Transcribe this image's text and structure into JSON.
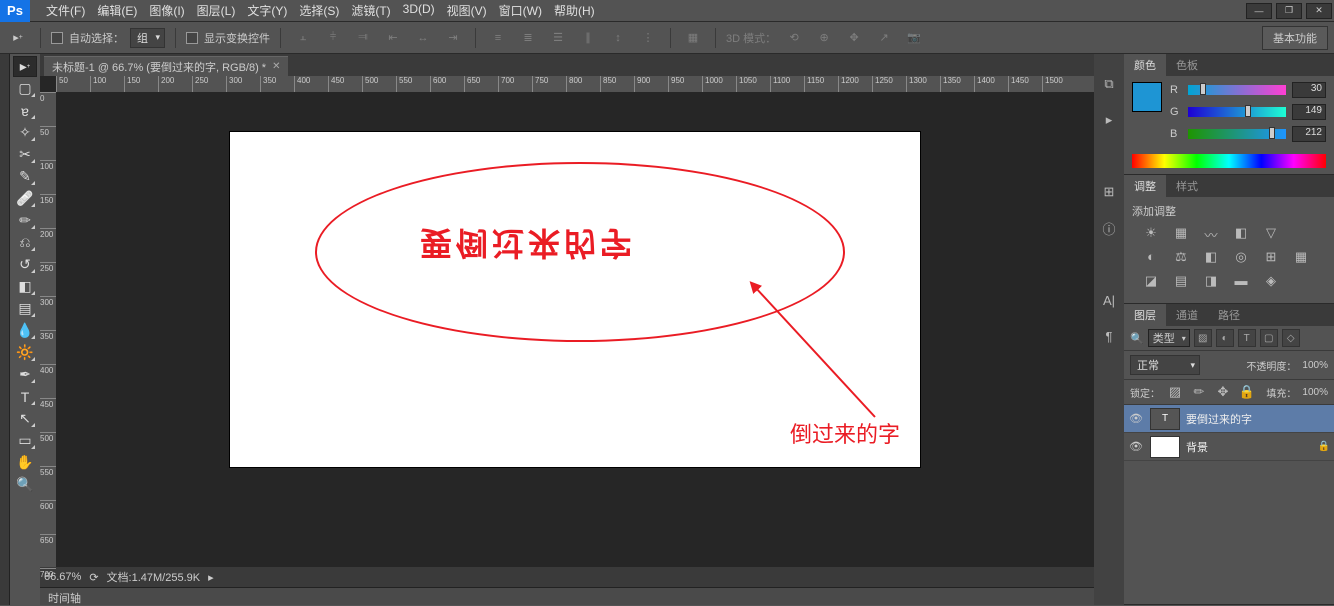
{
  "menu": {
    "items": [
      "文件(F)",
      "编辑(E)",
      "图像(I)",
      "图层(L)",
      "文字(Y)",
      "选择(S)",
      "滤镜(T)",
      "3D(D)",
      "视图(V)",
      "窗口(W)",
      "帮助(H)"
    ]
  },
  "options": {
    "auto_select_label": "自动选择：",
    "auto_select_value": "组",
    "show_transform_label": "显示变换控件",
    "mode3d_label": "3D 模式：",
    "workspace_btn": "基本功能"
  },
  "doc": {
    "tab_title": "未标题-1 @ 66.7% (要倒过来的字, RGB/8) *",
    "zoom": "66.67%",
    "doc_info": "文档:1.47M/255.9K",
    "timeline_tab": "时间轴",
    "canvas_text": "要倒过来的字",
    "annotation": "倒过来的字"
  },
  "ruler_h": [
    "50",
    "100",
    "150",
    "200",
    "250",
    "300",
    "350",
    "400",
    "450",
    "500",
    "550",
    "600",
    "650",
    "700",
    "750",
    "800",
    "850",
    "900",
    "950",
    "1000",
    "1050",
    "1100",
    "1150",
    "1200",
    "1250",
    "1300",
    "1350",
    "1400",
    "1450",
    "1500"
  ],
  "ruler_v": [
    "0",
    "50",
    "100",
    "150",
    "200",
    "250",
    "300",
    "350",
    "400",
    "450",
    "500",
    "550",
    "600",
    "650",
    "700"
  ],
  "color_panel": {
    "tab1": "颜色",
    "tab2": "色板",
    "r": {
      "label": "R",
      "val": "30"
    },
    "g": {
      "label": "G",
      "val": "149"
    },
    "b": {
      "label": "B",
      "val": "212"
    }
  },
  "adjust_panel": {
    "tab1": "调整",
    "tab2": "样式",
    "title": "添加调整"
  },
  "layers_panel": {
    "tab1": "图层",
    "tab2": "通道",
    "tab3": "路径",
    "search_label": "类型",
    "blend": "正常",
    "opacity_label": "不透明度：",
    "opacity_val": "100%",
    "lock_label": "锁定：",
    "fill_label": "填充：",
    "fill_val": "100%",
    "layers": [
      {
        "name": "要倒过来的字",
        "type": "T",
        "selected": true,
        "locked": false
      },
      {
        "name": "背景",
        "type": "bg",
        "selected": false,
        "locked": true
      }
    ]
  },
  "search_icon": "🔍"
}
